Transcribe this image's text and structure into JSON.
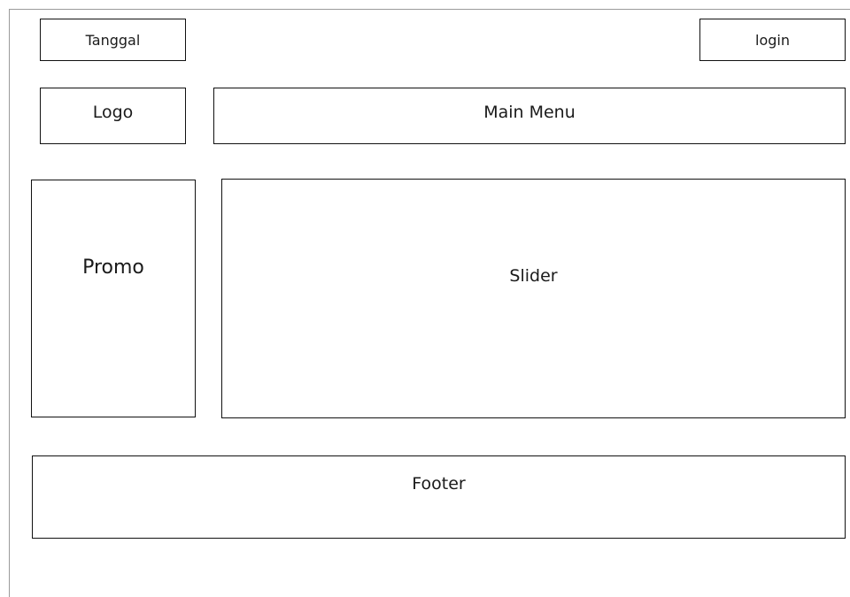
{
  "wireframe": {
    "tanggal": "Tanggal",
    "login": "login",
    "logo": "Logo",
    "main_menu": "Main Menu",
    "promo": "Promo",
    "slider": "Slider",
    "footer": "Footer"
  }
}
